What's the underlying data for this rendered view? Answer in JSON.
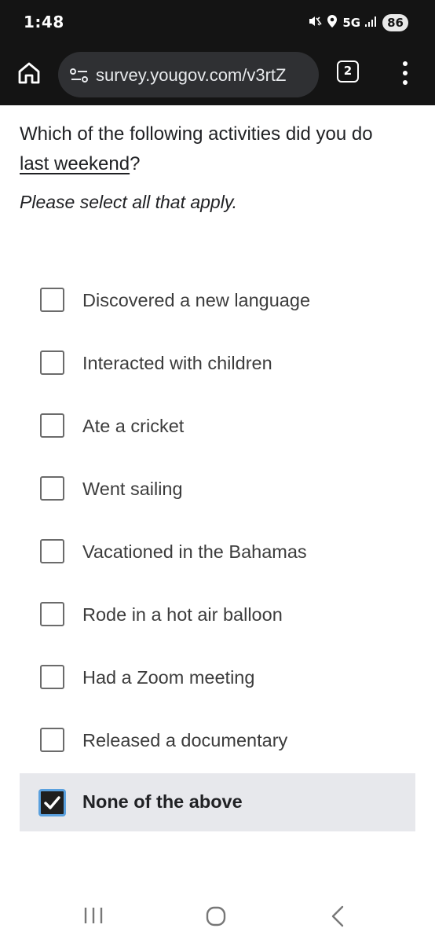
{
  "status_bar": {
    "time": "1:48",
    "network": "5G",
    "battery": "86",
    "icons": [
      "mute-icon",
      "location-icon",
      "signal-icon"
    ]
  },
  "browser": {
    "url": "survey.yougov.com/v3rtZ",
    "tab_count": "2",
    "icons": [
      "home-icon",
      "site-info-icon",
      "tabs-icon",
      "more-menu-icon"
    ]
  },
  "survey": {
    "question_part1": "Which of the following activities did you do",
    "question_underlined": "last weekend",
    "question_end": "?",
    "instruction": "Please select all that apply.",
    "options": [
      {
        "label": "Discovered a new language",
        "checked": false
      },
      {
        "label": "Interacted with children",
        "checked": false
      },
      {
        "label": "Ate a cricket",
        "checked": false
      },
      {
        "label": "Went sailing",
        "checked": false
      },
      {
        "label": "Vacationed in the Bahamas",
        "checked": false
      },
      {
        "label": "Rode in a hot air balloon",
        "checked": false
      },
      {
        "label": "Had a Zoom meeting",
        "checked": false
      },
      {
        "label": "Released a documentary",
        "checked": false
      },
      {
        "label": "None of the above",
        "checked": true
      }
    ]
  },
  "nav_bar": {
    "icons": [
      "recents-icon",
      "home-circle-icon",
      "back-icon"
    ]
  },
  "colors": {
    "chrome_dark": "#141414",
    "url_bar": "#2f3033",
    "selected_row": "#e7e8ec",
    "checkbox_focus": "#5aa0de"
  }
}
